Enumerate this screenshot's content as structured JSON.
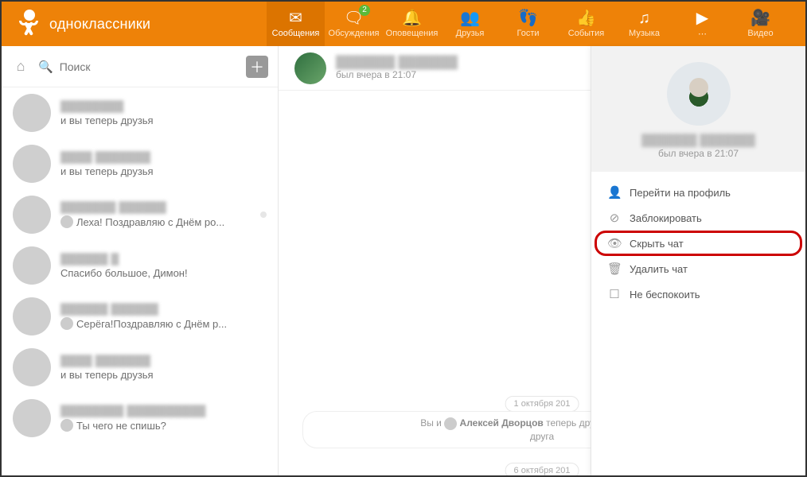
{
  "brand": {
    "name": "одноклассники"
  },
  "nav": {
    "items": [
      {
        "label": "Сообщения",
        "icon": "✉",
        "active": true,
        "badge": null
      },
      {
        "label": "Обсуждения",
        "icon": "🗨",
        "active": false,
        "badge": "2"
      },
      {
        "label": "Оповещения",
        "icon": "🔔",
        "active": false,
        "badge": null
      },
      {
        "label": "Друзья",
        "icon": "👥",
        "active": false,
        "badge": null
      },
      {
        "label": "Гости",
        "icon": "👣",
        "active": false,
        "badge": null
      },
      {
        "label": "События",
        "icon": "👍",
        "active": false,
        "badge": null
      },
      {
        "label": "Музыка",
        "icon": "♫",
        "active": false,
        "badge": null
      },
      {
        "label": "⋯",
        "icon": "▶",
        "active": false,
        "badge": null
      },
      {
        "label": "Видео",
        "icon": "🎥",
        "active": false,
        "badge": null
      }
    ]
  },
  "search": {
    "placeholder": "Поиск"
  },
  "chat_list": [
    {
      "name": "████████",
      "preview": "и вы теперь друзья",
      "mini": false
    },
    {
      "name": "████ ███████",
      "preview": "и вы теперь друзья",
      "mini": false
    },
    {
      "name": "███████ ██████",
      "preview": "Леха! Поздравляю с Днём ро...",
      "mini": true,
      "unread_dot": true
    },
    {
      "name": "██████ █",
      "preview": "Спасибо большое, Димон!",
      "mini": false
    },
    {
      "name": "██████ ██████",
      "preview": "Серёга!Поздравляю с Днём р...",
      "mini": true
    },
    {
      "name": "████ ███████",
      "preview": "и вы теперь друзья",
      "mini": false
    },
    {
      "name": "████████ ██████████",
      "preview": "Ты чего не спишь?",
      "mini": true
    }
  ],
  "conversation": {
    "name": "███████ ███████",
    "status": "был вчера в 21:07",
    "date1": "1 октября 201",
    "date2": "6 октября 201",
    "system_msg_prefix": "Вы и ",
    "system_msg_name": "Алексей Дворцов",
    "system_msg_suffix": " теперь друзья на Однокла",
    "system_msg_line2": "друга"
  },
  "side_panel": {
    "name": "███████ ███████",
    "status": "был вчера в 21:07",
    "menu": [
      {
        "icon": "👤",
        "label": "Перейти на профиль",
        "hl": false
      },
      {
        "icon": "⊘",
        "label": "Заблокировать",
        "hl": false
      },
      {
        "icon": "👁",
        "label": "Скрыть чат",
        "hl": true
      },
      {
        "icon": "🗑",
        "label": "Удалить чат",
        "hl": false
      },
      {
        "icon": "☐",
        "label": "Не беспокоить",
        "hl": false
      }
    ]
  },
  "colors": {
    "accent": "#ee8208",
    "highlight_border": "#c00",
    "badge": "#5bba3a"
  }
}
